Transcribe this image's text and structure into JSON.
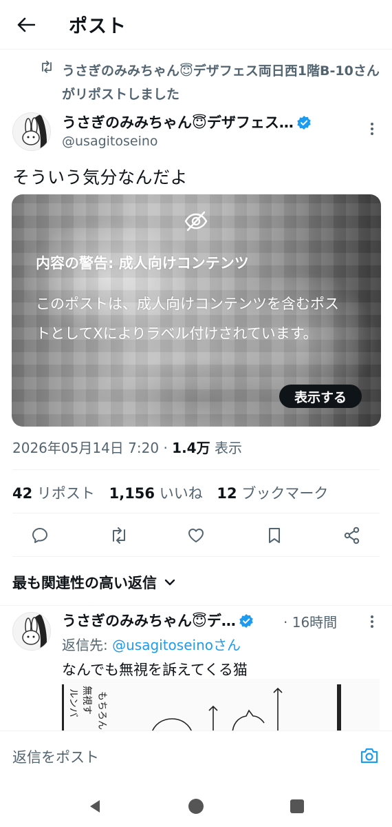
{
  "header": {
    "title": "ポスト",
    "back_icon": "arrow-left-icon"
  },
  "repost": {
    "icon": "repost-icon",
    "text": "うさぎのみみちゃん😇デザフェス両日西1階B-10さんがリポストしました"
  },
  "author": {
    "name": "うさぎのみみちゃん😇デザフェス…",
    "handle": "@usagitoseino",
    "verified": true
  },
  "post": {
    "text": "そういう気分なんだよ",
    "media_warning": {
      "title": "内容の警告: 成人向けコンテンツ",
      "body": "このポストは、成人向けコンテンツを含むポストとしてXによりラベル付けされています。",
      "show_label": "表示する"
    },
    "meta": {
      "datetime": "2026年05月14日 7:20",
      "separator": "·",
      "views_count": "1.4万",
      "views_label": "表示"
    },
    "stats": {
      "reposts_count": "42",
      "reposts_label": "リポスト",
      "likes_count": "1,156",
      "likes_label": "いいね",
      "bookmarks_count": "12",
      "bookmarks_label": "ブックマーク"
    }
  },
  "replies": {
    "sort_label": "最も関連性の高い返信",
    "items": [
      {
        "name": "うさぎのみみちゃん😇デ…",
        "time": "· 16時間",
        "reply_to_label": "返信先: ",
        "reply_to_handle": "@usagitoseinoさん",
        "text": "なんでも無視を訴えてくる猫",
        "image_text": [
          "もちろん",
          "無視す",
          "ルンバ"
        ]
      }
    ]
  },
  "compose": {
    "placeholder": "返信をポスト",
    "camera_icon": "camera-icon"
  },
  "colors": {
    "accent": "#1d9bf0",
    "text": "#0f1419",
    "secondary": "#536471",
    "divider": "#eff3f4"
  }
}
